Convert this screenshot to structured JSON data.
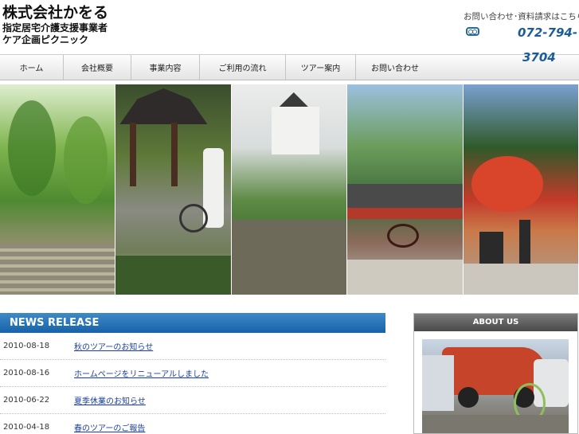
{
  "header": {
    "logo_main": "株式会社かをる",
    "logo_sub1": "指定居宅介護支援事業者",
    "logo_sub2": "ケア企画ピクニック",
    "contact_label": "お問い合わせ･資料請求はこちら",
    "phone_line1": "072-794-",
    "phone_line2": "3704"
  },
  "nav": {
    "items": [
      {
        "label": "ホーム"
      },
      {
        "label": "会社概要"
      },
      {
        "label": "事業内容"
      },
      {
        "label": "ご利用の流れ"
      },
      {
        "label": "ツアー案内"
      },
      {
        "label": "お問い合わせ"
      }
    ]
  },
  "news": {
    "title": "NEWS RELEASE",
    "items": [
      {
        "date": "2010-08-18",
        "text": "秋のツアーのお知らせ"
      },
      {
        "date": "2010-08-16",
        "text": "ホームページをリニューアルしました"
      },
      {
        "date": "2010-06-22",
        "text": "夏季休業のお知らせ"
      },
      {
        "date": "2010-04-18",
        "text": "春のツアーのご報告"
      }
    ]
  },
  "about": {
    "title": "ABOUT US"
  },
  "colors": {
    "news_header": "#1762a8",
    "phone": "#1a5c9a",
    "about_header": "#4a4a4a"
  }
}
